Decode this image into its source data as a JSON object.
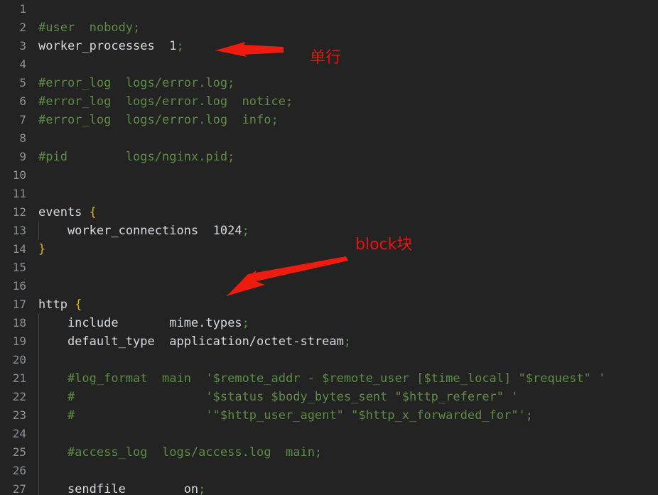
{
  "editor": {
    "language": "nginx-conf",
    "theme": "dark",
    "background_color": "#232323",
    "line_number_color": "#8a9199",
    "comment_color": "#5f8c46",
    "code_color": "#d6dbe0",
    "brace_color": "#d7b026",
    "annotation_color": "#ee1111",
    "first_visible_line": 1,
    "last_visible_line": 27,
    "total_visible_lines": 27
  },
  "line_numbers": [
    "1",
    "2",
    "3",
    "4",
    "5",
    "6",
    "7",
    "8",
    "9",
    "10",
    "11",
    "12",
    "13",
    "14",
    "15",
    "16",
    "17",
    "18",
    "19",
    "20",
    "21",
    "22",
    "23",
    "24",
    "25",
    "26",
    "27"
  ],
  "lines": [
    {
      "n": "1",
      "text": ""
    },
    {
      "n": "2",
      "text": "#user  nobody;"
    },
    {
      "n": "3",
      "text": "worker_processes  1;"
    },
    {
      "n": "4",
      "text": ""
    },
    {
      "n": "5",
      "text": "#error_log  logs/error.log;"
    },
    {
      "n": "6",
      "text": "#error_log  logs/error.log  notice;"
    },
    {
      "n": "7",
      "text": "#error_log  logs/error.log  info;"
    },
    {
      "n": "8",
      "text": ""
    },
    {
      "n": "9",
      "text": "#pid        logs/nginx.pid;"
    },
    {
      "n": "10",
      "text": ""
    },
    {
      "n": "11",
      "text": ""
    },
    {
      "n": "12",
      "text": "events {"
    },
    {
      "n": "13",
      "text": "    worker_connections  1024;"
    },
    {
      "n": "14",
      "text": "}"
    },
    {
      "n": "15",
      "text": ""
    },
    {
      "n": "16",
      "text": ""
    },
    {
      "n": "17",
      "text": "http {"
    },
    {
      "n": "18",
      "text": "    include       mime.types;"
    },
    {
      "n": "19",
      "text": "    default_type  application/octet-stream;"
    },
    {
      "n": "20",
      "text": ""
    },
    {
      "n": "21",
      "text": "    #log_format  main  '$remote_addr - $remote_user [$time_local] \"$request\" '"
    },
    {
      "n": "22",
      "text": "    #                  '$status $body_bytes_sent \"$http_referer\" '"
    },
    {
      "n": "23",
      "text": "    #                  '\"$http_user_agent\" \"$http_x_forwarded_for\"';"
    },
    {
      "n": "24",
      "text": ""
    },
    {
      "n": "25",
      "text": "    #access_log  logs/access.log  main;"
    },
    {
      "n": "26",
      "text": ""
    },
    {
      "n": "27",
      "text": "    sendfile        on;"
    }
  ],
  "annotations": [
    {
      "id": "single-line",
      "label": "单行",
      "color": "#ee1111",
      "points_to_line": "3",
      "arrow_direction": "left"
    },
    {
      "id": "block",
      "label": "block块",
      "color": "#ee1111",
      "points_to_line": "17",
      "arrow_direction": "down-left"
    }
  ]
}
